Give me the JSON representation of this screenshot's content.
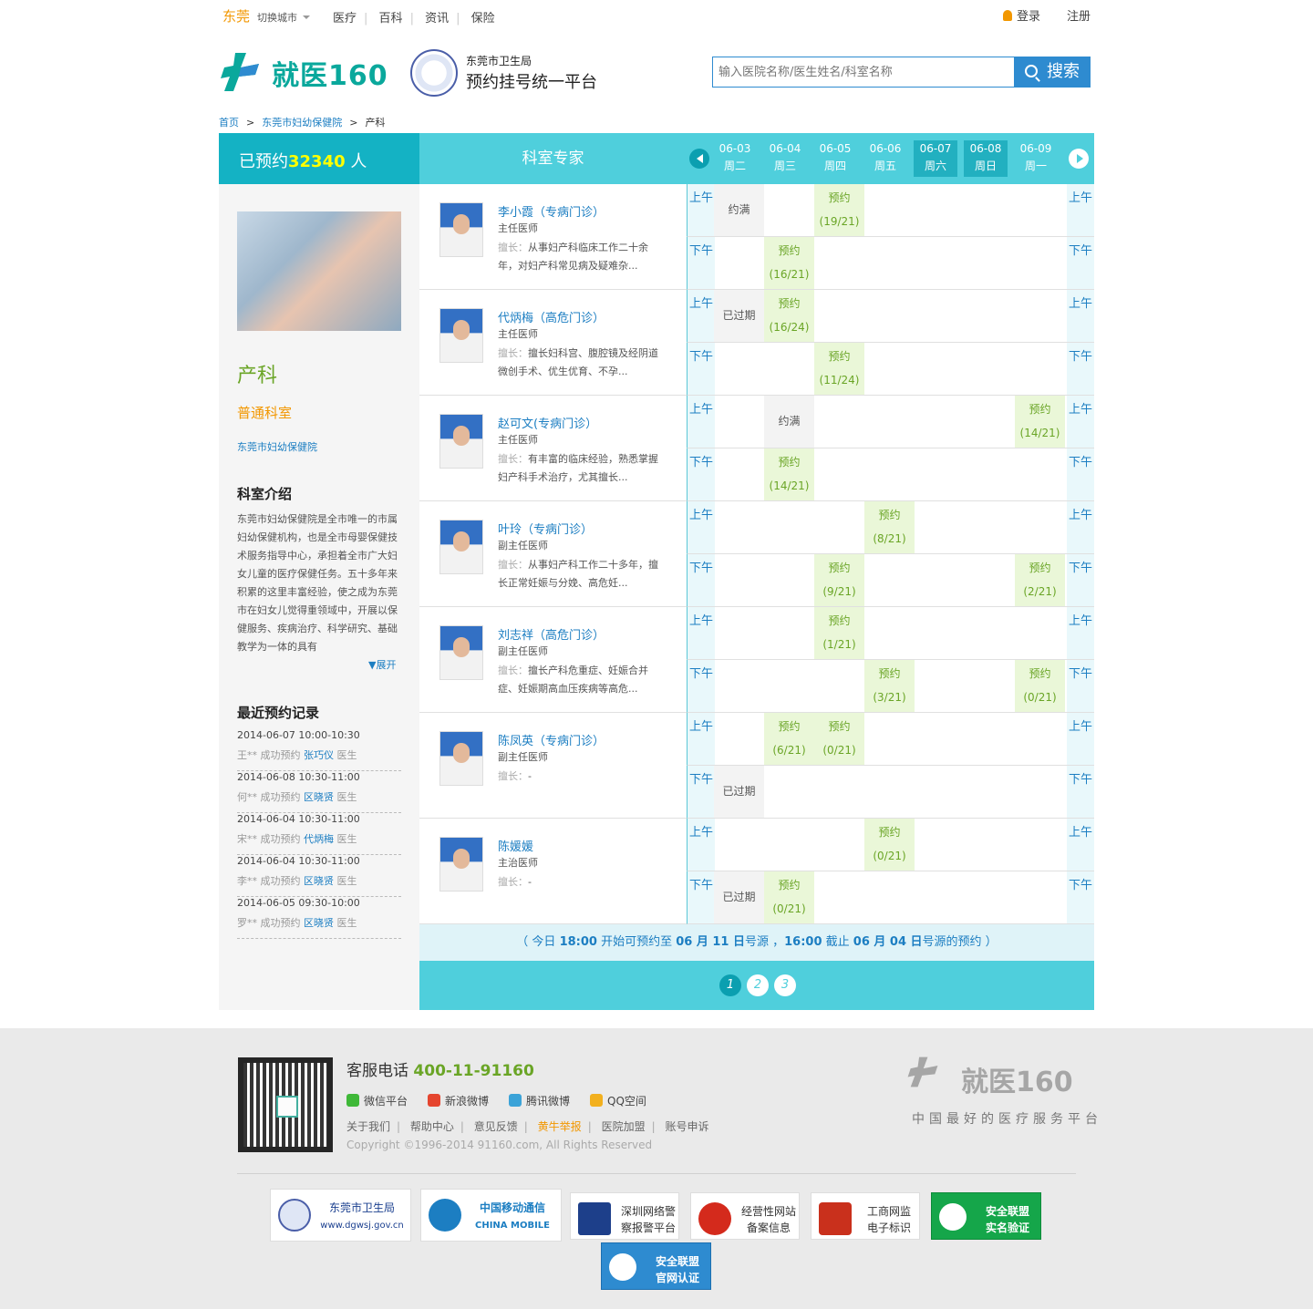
{
  "topbar": {
    "city": "东莞",
    "switch": "切换城市",
    "nav": [
      "医疗",
      "百科",
      "资讯",
      "保险"
    ],
    "login": "登录",
    "register": "注册"
  },
  "header": {
    "logo_text": "就医160",
    "bureau": "东莞市卫生局",
    "platform": "预约挂号统一平台",
    "search_placeholder": "输入医院名称/医生姓名/科室名称",
    "search_button": "搜索"
  },
  "breadcrumb": [
    "首页",
    "东莞市妇幼保健院",
    "产科"
  ],
  "sidebar": {
    "booked_prefix": "已预约",
    "booked_count": "32340",
    "booked_suffix": "人",
    "dept_name": "产科",
    "dept_type": "普通科室",
    "hospital": "东莞市妇幼保健院",
    "intro_title": "科室介绍",
    "intro_text": "东莞市妇幼保健院是全市唯一的市属妇幼保健机构，也是全市母婴保健技术服务指导中心，承担着全市广大妇女儿童的医疗保健任务。五十多年来积累的这里丰富经验，使之成为东莞市在妇女儿觉得重领域中，开展以保健服务、疾病治疗、科学研究、基础教学为一体的具有",
    "expand": "▼展开",
    "recent_title": "最近预约记录",
    "records": [
      {
        "time": "2014-06-07 10:00-10:30",
        "patient": "王**",
        "action": "成功预约",
        "doctor": "张巧仪",
        "suffix": "医生"
      },
      {
        "time": "2014-06-08 10:30-11:00",
        "patient": "何**",
        "action": "成功预约",
        "doctor": "区晓贤",
        "suffix": "医生"
      },
      {
        "time": "2014-06-04 10:30-11:00",
        "patient": "宋**",
        "action": "成功预约",
        "doctor": "代炳梅",
        "suffix": "医生"
      },
      {
        "time": "2014-06-04 10:30-11:00",
        "patient": "李**",
        "action": "成功预约",
        "doctor": "区晓贤",
        "suffix": "医生"
      },
      {
        "time": "2014-06-05 09:30-10:00",
        "patient": "罗**",
        "action": "成功预约",
        "doctor": "区晓贤",
        "suffix": "医生"
      }
    ]
  },
  "table": {
    "expert_header": "科室专家",
    "days": [
      {
        "date": "06-03",
        "week": "周二",
        "weekend": false
      },
      {
        "date": "06-04",
        "week": "周三",
        "weekend": false
      },
      {
        "date": "06-05",
        "week": "周四",
        "weekend": false
      },
      {
        "date": "06-06",
        "week": "周五",
        "weekend": false
      },
      {
        "date": "06-07",
        "week": "周六",
        "weekend": true
      },
      {
        "date": "06-08",
        "week": "周日",
        "weekend": true
      },
      {
        "date": "06-09",
        "week": "周一",
        "weekend": false
      }
    ],
    "am_label": "上午",
    "pm_label": "下午",
    "specialty_label": "擅长：",
    "doctors": [
      {
        "name": "李小霞（专病门诊）",
        "title": "主任医师",
        "specialty": "从事妇产科临床工作二十余年，对妇产科常见病及疑难杂...",
        "am": [
          {
            "col": 0,
            "kind": "full",
            "text": "约满"
          },
          {
            "col": 2,
            "kind": "ok",
            "text": "预约",
            "count": "(19/21)"
          }
        ],
        "pm": [
          {
            "col": 1,
            "kind": "ok",
            "text": "预约",
            "count": "(16/21)"
          }
        ]
      },
      {
        "name": "代炳梅（高危门诊）",
        "title": "主任医师",
        "specialty": "擅长妇科宫、腹腔镜及经阴道微创手术、优生优育、不孕...",
        "am": [
          {
            "col": 0,
            "kind": "exp",
            "text": "已过期"
          },
          {
            "col": 1,
            "kind": "ok",
            "text": "预约",
            "count": "(16/24)"
          }
        ],
        "pm": [
          {
            "col": 2,
            "kind": "ok",
            "text": "预约",
            "count": "(11/24)"
          }
        ]
      },
      {
        "name": "赵可文(专病门诊）",
        "title": "主任医师",
        "specialty": "有丰富的临床经验，熟悉掌握妇产科手术治疗，尤其擅长...",
        "am": [
          {
            "col": 1,
            "kind": "full",
            "text": "约满"
          },
          {
            "col": 6,
            "kind": "ok",
            "text": "预约",
            "count": "(14/21)"
          }
        ],
        "pm": [
          {
            "col": 1,
            "kind": "ok",
            "text": "预约",
            "count": "(14/21)"
          }
        ]
      },
      {
        "name": "叶玲（专病门诊）",
        "title": "副主任医师",
        "specialty": "从事妇产科工作二十多年，擅长正常妊娠与分娩、高危妊...",
        "am": [
          {
            "col": 3,
            "kind": "ok",
            "text": "预约",
            "count": "(8/21)"
          }
        ],
        "pm": [
          {
            "col": 2,
            "kind": "ok",
            "text": "预约",
            "count": "(9/21)"
          },
          {
            "col": 6,
            "kind": "ok",
            "text": "预约",
            "count": "(2/21)"
          }
        ]
      },
      {
        "name": "刘志祥（高危门诊）",
        "title": "副主任医师",
        "specialty": "擅长产科危重症、妊娠合并症、妊娠期高血压疾病等高危...",
        "am": [
          {
            "col": 2,
            "kind": "ok",
            "text": "预约",
            "count": "(1/21)"
          }
        ],
        "pm": [
          {
            "col": 3,
            "kind": "ok",
            "text": "预约",
            "count": "(3/21)"
          },
          {
            "col": 6,
            "kind": "ok",
            "text": "预约",
            "count": "(0/21)"
          }
        ]
      },
      {
        "name": "陈凤英（专病门诊）",
        "title": "副主任医师",
        "specialty": "-",
        "am": [
          {
            "col": 1,
            "kind": "ok",
            "text": "预约",
            "count": "(6/21)"
          },
          {
            "col": 2,
            "kind": "ok",
            "text": "预约",
            "count": "(0/21)"
          }
        ],
        "pm": [
          {
            "col": 0,
            "kind": "exp",
            "text": "已过期"
          }
        ]
      },
      {
        "name": "陈媛媛",
        "title": "主治医师",
        "specialty": "-",
        "am": [
          {
            "col": 3,
            "kind": "ok",
            "text": "预约",
            "count": "(0/21)"
          }
        ],
        "pm": [
          {
            "col": 0,
            "kind": "exp",
            "text": "已过期"
          },
          {
            "col": 1,
            "kind": "ok",
            "text": "预约",
            "count": "(0/21)"
          }
        ]
      }
    ],
    "notice": {
      "p1": "（ 今日 ",
      "t1": "18:00",
      "p2": " 开始可预约至 ",
      "t2": "06 月 11 日",
      "p3": "号源 ，",
      "t3": "16:00",
      "p4": " 截止 ",
      "t4": "06 月 04 日",
      "p5": "号源的预约 ）"
    },
    "pages": [
      "1",
      "2",
      "3"
    ]
  },
  "footer": {
    "hotline_label": "客服电话",
    "hotline": "400-11-91160",
    "social": [
      "微信平台",
      "新浪微博",
      "腾讯微博",
      "QQ空间"
    ],
    "links": [
      "关于我们",
      "帮助中心",
      "意见反馈",
      "黄牛举报",
      "医院加盟",
      "账号申诉"
    ],
    "copyright": "Copyright ©1996-2014 91160.com, All Rights Reserved",
    "logo_text": "就医160",
    "slogan": "中国最好的医疗服务平台",
    "badges": [
      {
        "line1": "东莞市卫生局",
        "line2": "www.dgwsj.gov.cn"
      },
      {
        "line1": "中国移动通信",
        "line2": "CHINA MOBILE"
      },
      {
        "line1": "深圳网络警",
        "line2": "察报警平台"
      },
      {
        "line1": "经营性网站",
        "line2": "备案信息"
      },
      {
        "line1": "工商网监",
        "line2": "电子标识"
      },
      {
        "line1": "安全联盟",
        "line2": "实名验证"
      },
      {
        "line1": "安全联盟",
        "line2": "官网认证"
      }
    ],
    "colors": {
      "brand_teal": "#4fcfdc",
      "accent_green": "#6aa526",
      "accent_orange": "#f29700",
      "link_blue": "#1c7ec2"
    }
  }
}
